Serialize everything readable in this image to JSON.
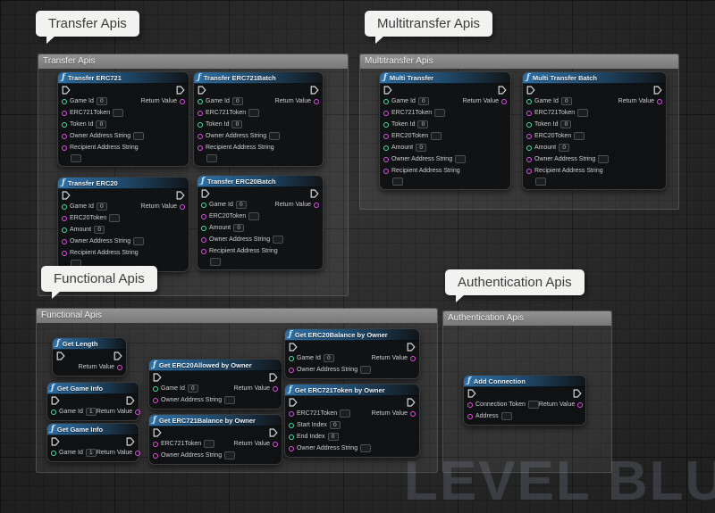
{
  "canvas": {
    "watermark": "LEVEL BLU"
  },
  "colors": {
    "exec": "#d8d8d8",
    "int": "#49e3a5",
    "string": "#e24fe2"
  },
  "bubbles": {
    "transfer": "Transfer Apis",
    "multitransfer": "Multitransfer Apis",
    "functional": "Functional Apis",
    "authentication": "Authentication Apis"
  },
  "comments": {
    "transfer": "Transfer Apis",
    "multitransfer": "Multitransfer Apis",
    "functional": "Functional Apis",
    "authentication": "Authentication Apis"
  },
  "nodes": {
    "transfer_erc721": {
      "title": "Transfer ERC721",
      "exec_in": true,
      "exec_out": true,
      "inputs": [
        {
          "label": "Game Id",
          "type": "int",
          "value": "0"
        },
        {
          "label": "ERC721Token",
          "type": "string",
          "value": ""
        },
        {
          "label": "Token Id",
          "type": "int",
          "value": "0"
        },
        {
          "label": "Owner Address String",
          "type": "string",
          "value": ""
        },
        {
          "label": "Recipient Address String",
          "type": "string",
          "value": "",
          "wrap": true
        }
      ],
      "outputs": [
        {
          "label": "Return Value",
          "type": "string"
        }
      ]
    },
    "transfer_erc721batch": {
      "title": "Transfer ERC721Batch",
      "exec_in": true,
      "exec_out": true,
      "inputs": [
        {
          "label": "Game Id",
          "type": "int",
          "value": "0"
        },
        {
          "label": "ERC721Token",
          "type": "string",
          "value": ""
        },
        {
          "label": "Token Id",
          "type": "int",
          "value": "0"
        },
        {
          "label": "Owner Address String",
          "type": "string",
          "value": ""
        },
        {
          "label": "Recipient Address String",
          "type": "string",
          "value": "",
          "wrap": true
        }
      ],
      "outputs": [
        {
          "label": "Return Value",
          "type": "string"
        }
      ]
    },
    "transfer_erc20": {
      "title": "Transfer ERC20",
      "exec_in": true,
      "exec_out": true,
      "inputs": [
        {
          "label": "Game Id",
          "type": "int",
          "value": "0"
        },
        {
          "label": "ERC20Token",
          "type": "string",
          "value": ""
        },
        {
          "label": "Amount",
          "type": "int",
          "value": "0"
        },
        {
          "label": "Owner Address String",
          "type": "string",
          "value": ""
        },
        {
          "label": "Recipient Address String",
          "type": "string",
          "value": "",
          "wrap": true
        }
      ],
      "outputs": [
        {
          "label": "Return Value",
          "type": "string"
        }
      ]
    },
    "transfer_erc20batch": {
      "title": "Transfer ERC20Batch",
      "exec_in": true,
      "exec_out": true,
      "inputs": [
        {
          "label": "Game Id",
          "type": "int",
          "value": "0"
        },
        {
          "label": "ERC20Token",
          "type": "string",
          "value": ""
        },
        {
          "label": "Amount",
          "type": "int",
          "value": "0"
        },
        {
          "label": "Owner Address String",
          "type": "string",
          "value": ""
        },
        {
          "label": "Recipient Address String",
          "type": "string",
          "value": "",
          "wrap": true
        }
      ],
      "outputs": [
        {
          "label": "Return Value",
          "type": "string"
        }
      ]
    },
    "multi_transfer": {
      "title": "Multi Transfer",
      "exec_in": true,
      "exec_out": true,
      "inputs": [
        {
          "label": "Game Id",
          "type": "int",
          "value": "0"
        },
        {
          "label": "ERC721Token",
          "type": "string",
          "value": ""
        },
        {
          "label": "Token Id",
          "type": "int",
          "value": "0"
        },
        {
          "label": "ERC20Token",
          "type": "string",
          "value": ""
        },
        {
          "label": "Amount",
          "type": "int",
          "value": "0"
        },
        {
          "label": "Owner Address String",
          "type": "string",
          "value": ""
        },
        {
          "label": "Recipient Address String",
          "type": "string",
          "value": "",
          "wrap": true
        }
      ],
      "outputs": [
        {
          "label": "Return Value",
          "type": "string"
        }
      ]
    },
    "multi_transfer_batch": {
      "title": "Multi Transfer Batch",
      "exec_in": true,
      "exec_out": true,
      "inputs": [
        {
          "label": "Game Id",
          "type": "int",
          "value": "0"
        },
        {
          "label": "ERC721Token",
          "type": "string",
          "value": ""
        },
        {
          "label": "Token Id",
          "type": "int",
          "value": "0"
        },
        {
          "label": "ERC20Token",
          "type": "string",
          "value": ""
        },
        {
          "label": "Amount",
          "type": "int",
          "value": "0"
        },
        {
          "label": "Owner Address String",
          "type": "string",
          "value": ""
        },
        {
          "label": "Recipient Address String",
          "type": "string",
          "value": "",
          "wrap": true
        }
      ],
      "outputs": [
        {
          "label": "Return Value",
          "type": "string"
        }
      ]
    },
    "get_length": {
      "title": "Get Length",
      "exec_in": true,
      "exec_out": true,
      "inputs": [],
      "outputs": [
        {
          "label": "Return Value",
          "type": "string"
        }
      ]
    },
    "get_game_info_1": {
      "title": "Get Game Info",
      "exec_in": true,
      "exec_out": true,
      "inputs": [
        {
          "label": "Game Id",
          "type": "int",
          "value": "1"
        }
      ],
      "outputs": [
        {
          "label": "Return Value",
          "type": "string"
        }
      ]
    },
    "get_game_info_2": {
      "title": "Get Game Info",
      "exec_in": true,
      "exec_out": true,
      "inputs": [
        {
          "label": "Game Id",
          "type": "int",
          "value": "1"
        }
      ],
      "outputs": [
        {
          "label": "Return Value",
          "type": "string"
        }
      ]
    },
    "get_erc20allowed": {
      "title": "Get ERC20Allowed by Owner",
      "exec_in": true,
      "exec_out": true,
      "inputs": [
        {
          "label": "Game Id",
          "type": "int",
          "value": "0"
        },
        {
          "label": "Owner Address String",
          "type": "string",
          "value": ""
        }
      ],
      "outputs": [
        {
          "label": "Return Value",
          "type": "string"
        }
      ]
    },
    "get_erc721balance": {
      "title": "Get ERC721Balance by Owner",
      "exec_in": true,
      "exec_out": true,
      "inputs": [
        {
          "label": "ERC721Token",
          "type": "string",
          "value": ""
        },
        {
          "label": "Owner Address String",
          "type": "string",
          "value": ""
        }
      ],
      "outputs": [
        {
          "label": "Return Value",
          "type": "string"
        }
      ]
    },
    "get_erc20balance": {
      "title": "Get ERC20Balance by Owner",
      "exec_in": true,
      "exec_out": true,
      "inputs": [
        {
          "label": "Game Id",
          "type": "int",
          "value": "0"
        },
        {
          "label": "Owner Address String",
          "type": "string",
          "value": ""
        }
      ],
      "outputs": [
        {
          "label": "Return Value",
          "type": "string"
        }
      ]
    },
    "get_erc721token": {
      "title": "Get ERC721Token by Owner",
      "exec_in": true,
      "exec_out": true,
      "inputs": [
        {
          "label": "ERC721Token",
          "type": "string",
          "value": ""
        },
        {
          "label": "Start Index",
          "type": "int",
          "value": "0"
        },
        {
          "label": "End Index",
          "type": "int",
          "value": "0"
        },
        {
          "label": "Owner Address String",
          "type": "string",
          "value": ""
        }
      ],
      "outputs": [
        {
          "label": "Return Value",
          "type": "string"
        }
      ]
    },
    "add_connection": {
      "title": "Add Connection",
      "exec_in": true,
      "exec_out": true,
      "inputs": [
        {
          "label": "Connection Token",
          "type": "string",
          "value": ""
        },
        {
          "label": "Address",
          "type": "string",
          "value": ""
        }
      ],
      "outputs": [
        {
          "label": "Return Value",
          "type": "string"
        }
      ]
    }
  }
}
